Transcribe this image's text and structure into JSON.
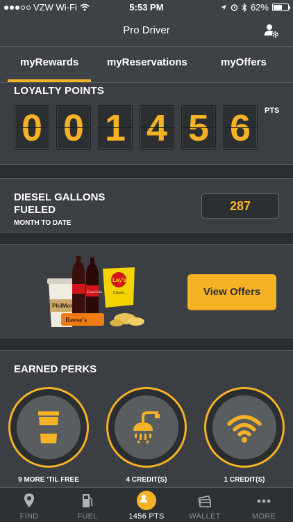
{
  "status_bar": {
    "carrier": "VZW Wi-Fi",
    "time": "5:53 PM",
    "battery": "62%",
    "battery_level": 0.62
  },
  "nav": {
    "title": "Pro Driver",
    "settings_icon": "user-settings-icon"
  },
  "tabs": [
    {
      "label": "myRewards",
      "active": true
    },
    {
      "label": "myReservations",
      "active": false
    },
    {
      "label": "myOffers",
      "active": false
    }
  ],
  "loyalty": {
    "label": "LOYALTY POINTS",
    "digits": [
      "0",
      "0",
      "1",
      "4",
      "5",
      "6"
    ],
    "unit": "PTS"
  },
  "diesel": {
    "label": "DIESEL GALLONS FUELED",
    "sublabel": "MONTH TO DATE",
    "value": "287"
  },
  "offers": {
    "button_label": "View Offers",
    "snack_brands": [
      "PhilMor",
      "Coca-Cola",
      "Lay's",
      "Classic",
      "Reese's"
    ]
  },
  "perks": {
    "label": "EARNED PERKS",
    "items": [
      {
        "icon": "coffee-cup-icon",
        "caption": "9 MORE 'TIL FREE"
      },
      {
        "icon": "shower-icon",
        "caption": "4 CREDIT(S)"
      },
      {
        "icon": "wifi-icon",
        "caption": "1 CREDIT(S)"
      }
    ]
  },
  "tab_bar": [
    {
      "label": "FIND",
      "icon": "location-pin-icon",
      "active": false
    },
    {
      "label": "FUEL",
      "icon": "fuel-pump-icon",
      "active": false
    },
    {
      "label": "1456 PTS",
      "icon": "profile-avatar-icon",
      "active": true
    },
    {
      "label": "WALLET",
      "icon": "wallet-cards-icon",
      "active": false
    },
    {
      "label": "MORE",
      "icon": "more-dots-icon",
      "active": false
    }
  ],
  "colors": {
    "accent": "#f5b224",
    "background": "#2b2e31",
    "panel": "#3b3e42"
  }
}
